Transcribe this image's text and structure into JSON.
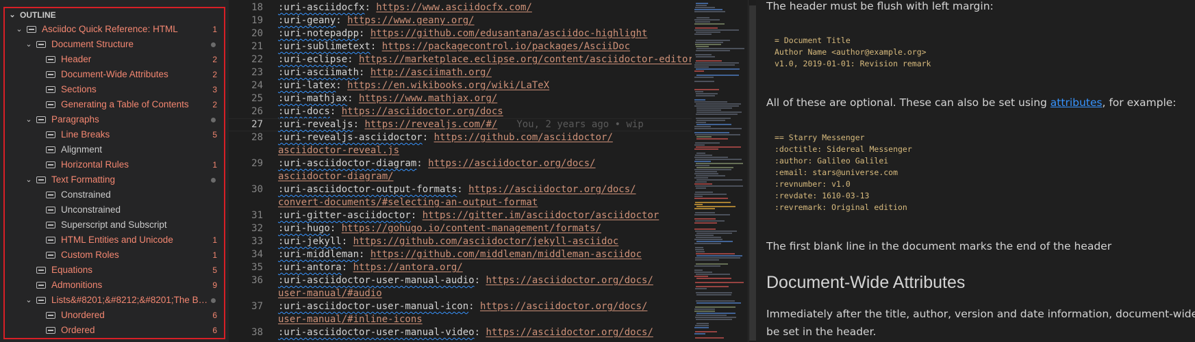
{
  "outline": {
    "header": "OUTLINE",
    "items": [
      {
        "label": "Asciidoc Quick Reference: HTML",
        "level": 0,
        "expanded": true,
        "badge": "1",
        "status": "err"
      },
      {
        "label": "Document Structure",
        "level": 1,
        "expanded": true,
        "badge": "",
        "dot": true,
        "status": "err"
      },
      {
        "label": "Header",
        "level": 2,
        "badge": "2",
        "status": "err"
      },
      {
        "label": "Document-Wide Attributes",
        "level": 2,
        "badge": "2",
        "status": "err"
      },
      {
        "label": "Sections",
        "level": 2,
        "badge": "3",
        "status": "err"
      },
      {
        "label": "Generating a Table of Contents",
        "level": 2,
        "badge": "2",
        "status": "err"
      },
      {
        "label": "Paragraphs",
        "level": 1,
        "expanded": true,
        "badge": "",
        "dot": true,
        "status": "err"
      },
      {
        "label": "Line Breaks",
        "level": 2,
        "badge": "5",
        "status": "err"
      },
      {
        "label": "Alignment",
        "level": 2,
        "badge": "",
        "status": "ok"
      },
      {
        "label": "Horizontal Rules",
        "level": 2,
        "badge": "1",
        "status": "err"
      },
      {
        "label": "Text Formatting",
        "level": 1,
        "expanded": true,
        "badge": "",
        "dot": true,
        "status": "err"
      },
      {
        "label": "Constrained",
        "level": 2,
        "badge": "",
        "status": "ok"
      },
      {
        "label": "Unconstrained",
        "level": 2,
        "badge": "",
        "status": "ok"
      },
      {
        "label": "Superscript and Subscript",
        "level": 2,
        "badge": "",
        "status": "ok"
      },
      {
        "label": "HTML Entities and Unicode",
        "level": 2,
        "badge": "1",
        "status": "err"
      },
      {
        "label": "Custom Roles",
        "level": 2,
        "badge": "1",
        "status": "err"
      },
      {
        "label": "Equations",
        "level": 1,
        "badge": "5",
        "status": "err"
      },
      {
        "label": "Admonitions",
        "level": 1,
        "badge": "9",
        "status": "err"
      },
      {
        "label": "Lists&#8201;&#8212;&#8201;The Ba...",
        "level": 1,
        "expanded": true,
        "badge": "",
        "dot": true,
        "status": "err"
      },
      {
        "label": "Unordered",
        "level": 2,
        "badge": "6",
        "status": "err"
      },
      {
        "label": "Ordered",
        "level": 2,
        "badge": "6",
        "status": "err"
      }
    ]
  },
  "editor": {
    "current_line": 27,
    "blame": "You, 2 years ago • wip",
    "lines": [
      {
        "num": "18",
        "parts": [
          {
            "key": ":uri-asciidocfx"
          },
          {
            "text": ": "
          },
          {
            "url": "https://www.asciidocfx.com/"
          }
        ]
      },
      {
        "num": "19",
        "parts": [
          {
            "key": ":uri-geany"
          },
          {
            "text": ": "
          },
          {
            "url": "https://www.geany.org/"
          }
        ]
      },
      {
        "num": "20",
        "parts": [
          {
            "key": ":uri-notepadpp"
          },
          {
            "text": ": "
          },
          {
            "url": "https://github.com/edusantana/asciidoc-highlight"
          }
        ]
      },
      {
        "num": "21",
        "parts": [
          {
            "key": ":uri-sublimetext"
          },
          {
            "text": ": "
          },
          {
            "url": "https://packagecontrol.io/packages/AsciiDoc"
          }
        ]
      },
      {
        "num": "22",
        "parts": [
          {
            "key": ":uri-eclipse"
          },
          {
            "text": ": "
          },
          {
            "url": "https://marketplace.eclipse.org/content/asciidoctor-editor"
          }
        ]
      },
      {
        "num": "23",
        "parts": [
          {
            "key": ":uri-asciimath"
          },
          {
            "text": ": "
          },
          {
            "url": "http://asciimath.org/"
          }
        ]
      },
      {
        "num": "24",
        "parts": [
          {
            "key": ":uri-latex"
          },
          {
            "text": ": "
          },
          {
            "url": "https://en.wikibooks.org/wiki/LaTeX"
          }
        ]
      },
      {
        "num": "25",
        "parts": [
          {
            "key": ":uri-mathjax"
          },
          {
            "text": ": "
          },
          {
            "url": "https://www.mathjax.org/"
          }
        ]
      },
      {
        "num": "26",
        "parts": [
          {
            "key": ":uri-docs"
          },
          {
            "text": ": "
          },
          {
            "url": "https://asciidoctor.org/docs"
          }
        ]
      },
      {
        "num": "27",
        "parts": [
          {
            "key": ":uri-revealjs"
          },
          {
            "text": ": "
          },
          {
            "url": "https://revealjs.com/#/"
          }
        ],
        "blame": true
      },
      {
        "num": "28",
        "parts": [
          {
            "key": ":uri-revealjs-asciidoctor"
          },
          {
            "text": ": "
          },
          {
            "url": "https://github.com/asciidoctor/"
          }
        ]
      },
      {
        "num": "",
        "parts": [
          {
            "url": "asciidoctor-reveal.js"
          }
        ]
      },
      {
        "num": "29",
        "parts": [
          {
            "key": ":uri-asciidoctor-diagram"
          },
          {
            "text": ": "
          },
          {
            "url": "https://asciidoctor.org/docs/"
          }
        ]
      },
      {
        "num": "",
        "parts": [
          {
            "url": "asciidoctor-diagram/"
          }
        ]
      },
      {
        "num": "30",
        "parts": [
          {
            "key": ":uri-asciidoctor-output-formats"
          },
          {
            "text": ": "
          },
          {
            "url": "https://asciidoctor.org/docs/"
          }
        ]
      },
      {
        "num": "",
        "parts": [
          {
            "url": "convert-documents/#selecting-an-output-format"
          }
        ]
      },
      {
        "num": "31",
        "parts": [
          {
            "key": ":uri-gitter-asciidoctor"
          },
          {
            "text": ": "
          },
          {
            "url": "https://gitter.im/asciidoctor/asciidoctor"
          }
        ]
      },
      {
        "num": "32",
        "parts": [
          {
            "key": ":uri-hugo"
          },
          {
            "text": ": "
          },
          {
            "url": "https://gohugo.io/content-management/formats/"
          }
        ]
      },
      {
        "num": "33",
        "parts": [
          {
            "key": ":uri-jekyll"
          },
          {
            "text": ": "
          },
          {
            "url": "https://github.com/asciidoctor/jekyll-asciidoc"
          }
        ]
      },
      {
        "num": "34",
        "parts": [
          {
            "key": ":uri-middleman"
          },
          {
            "text": ": "
          },
          {
            "url": "https://github.com/middleman/middleman-asciidoc"
          }
        ]
      },
      {
        "num": "35",
        "parts": [
          {
            "key": ":uri-antora"
          },
          {
            "text": ": "
          },
          {
            "url": "https://antora.org/"
          }
        ]
      },
      {
        "num": "36",
        "parts": [
          {
            "key": ":uri-asciidoctor-user-manual-audio"
          },
          {
            "text": ": "
          },
          {
            "url": "https://asciidoctor.org/docs/"
          }
        ]
      },
      {
        "num": "",
        "parts": [
          {
            "url": "user-manual/#audio"
          }
        ]
      },
      {
        "num": "37",
        "parts": [
          {
            "key": ":uri-asciidoctor-user-manual-icon"
          },
          {
            "text": ": "
          },
          {
            "url": "https://asciidoctor.org/docs/"
          }
        ]
      },
      {
        "num": "",
        "parts": [
          {
            "url": "user-manual/#inline-icons"
          }
        ]
      },
      {
        "num": "38",
        "parts": [
          {
            "key": ":uri-asciidoctor-user-manual-video"
          },
          {
            "text": ": "
          },
          {
            "url": "https://asciidoctor.org/docs/"
          }
        ]
      }
    ]
  },
  "preview": {
    "p1": "The header must be flush with left margin:",
    "code1": "= Document Title\nAuthor Name <author@example.org>\nv1.0, 2019-01-01: Revision remark",
    "p2_before": "All of these are optional. These can also be set using ",
    "p2_link": "attributes",
    "p2_after": ", for example:",
    "code2": "== Starry Messenger\n:doctitle: Sidereal Messenger\n:author: Galileo Galilei\n:email: stars@universe.com\n:revnumber: v1.0\n:revdate: 1610-03-13\n:revremark: Original edition",
    "p3": "The first blank line in the document marks the end of the header",
    "h2": "Document-Wide Attributes",
    "p4_line1": "Immediately after the title, author, version and date information, document-wide at",
    "p4_line2": "be set in the header."
  },
  "colors": {
    "error": "#f48771",
    "link": "#3794ff",
    "url": "#ce9178",
    "border_highlight": "#d81f26"
  }
}
